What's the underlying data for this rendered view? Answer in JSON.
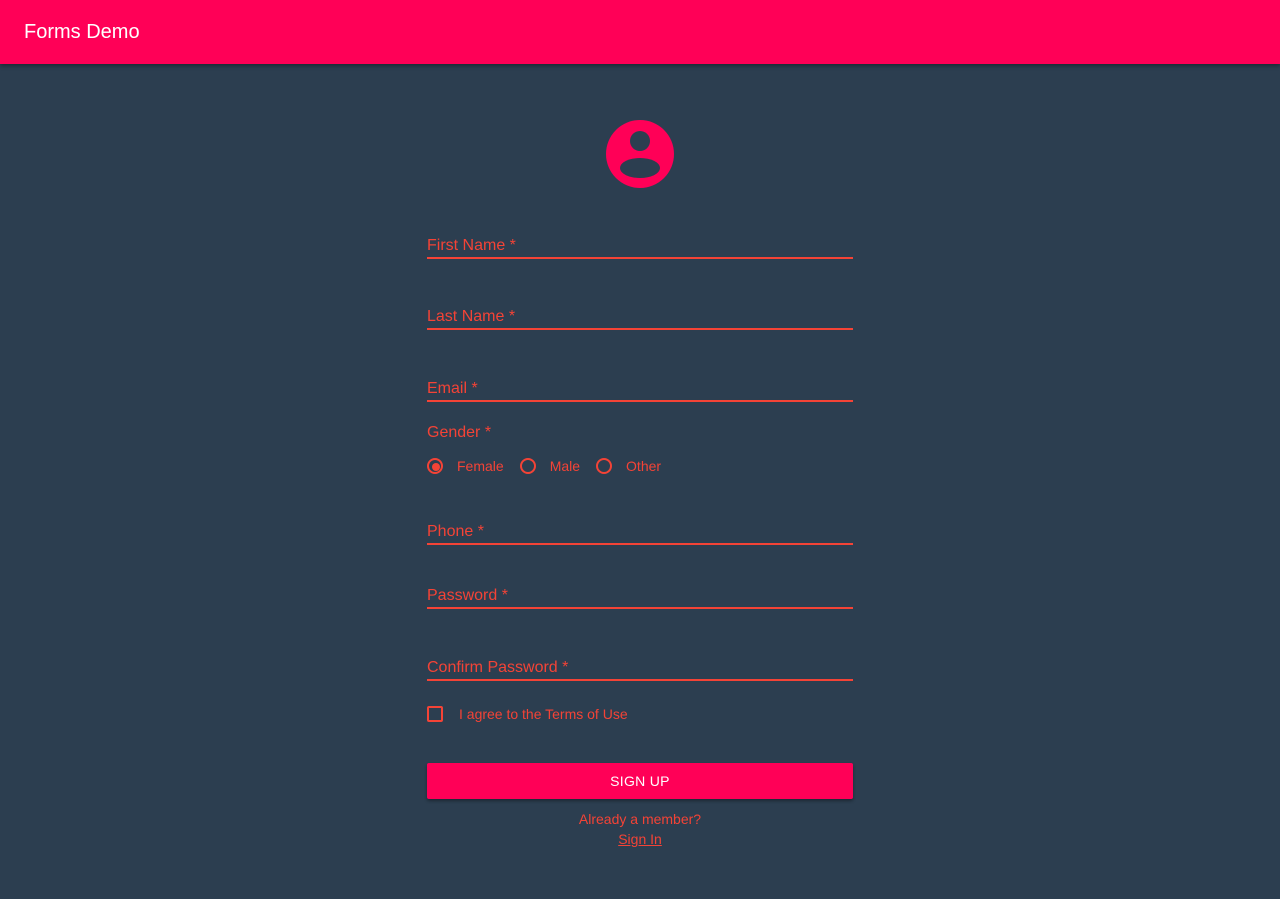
{
  "app": {
    "title": "Forms Demo",
    "colors": {
      "primary": "#ff0057",
      "accent": "#f44336",
      "background": "#2c3e50"
    }
  },
  "avatar": {
    "icon": "account-circle-icon"
  },
  "form": {
    "first_name": {
      "label": "First Name *",
      "value": ""
    },
    "last_name": {
      "label": "Last Name *",
      "value": ""
    },
    "email": {
      "label": "Email *",
      "value": ""
    },
    "gender": {
      "label": "Gender *",
      "selected": "Female",
      "options": [
        "Female",
        "Male",
        "Other"
      ]
    },
    "phone": {
      "label": "Phone *",
      "value": ""
    },
    "password": {
      "label": "Password *",
      "value": ""
    },
    "confirm_password": {
      "label": "Confirm Password *",
      "value": ""
    },
    "terms": {
      "label": "I agree to the Terms of Use",
      "checked": false
    },
    "submit_label": "SIGN UP",
    "member_prompt": "Already a member?",
    "signin_label": "Sign In"
  }
}
